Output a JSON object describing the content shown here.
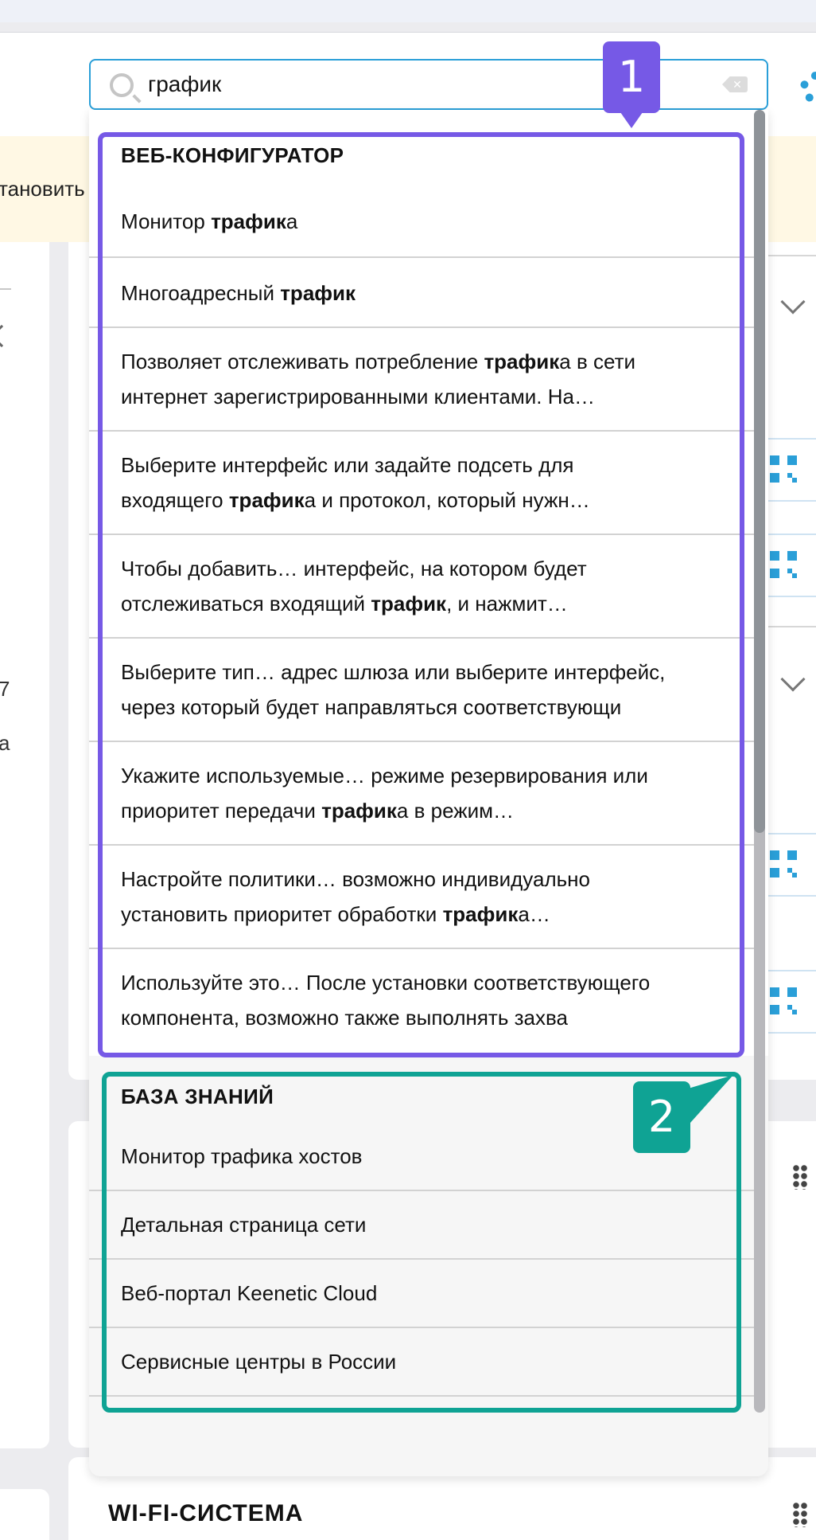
{
  "search": {
    "value": "график"
  },
  "page": {
    "notice_fragment": "тановить",
    "left_fragments": [
      "7",
      "a"
    ],
    "bottom_title": "WI-FI-СИСТЕМА"
  },
  "dropdown": {
    "web_section": {
      "title": "ВЕБ-КОНФИГУРАТОР",
      "results": [
        {
          "lines": [
            [
              {
                "t": "Монитор "
              },
              {
                "t": "трафик",
                "b": true
              },
              {
                "t": "а"
              }
            ]
          ]
        },
        {
          "lines": [
            [
              {
                "t": "Многоадресный "
              },
              {
                "t": "трафик",
                "b": true
              }
            ]
          ]
        },
        {
          "lines": [
            [
              {
                "t": "Позволяет отслеживать потребление "
              },
              {
                "t": "трафик",
                "b": true
              },
              {
                "t": "а в сети"
              }
            ],
            [
              {
                "t": "интернет зарегистрированными клиентами. На…"
              }
            ]
          ]
        },
        {
          "lines": [
            [
              {
                "t": "Выберите интерфейс или задайте подсеть для"
              }
            ],
            [
              {
                "t": "входящего "
              },
              {
                "t": "трафик",
                "b": true
              },
              {
                "t": "а и протокол, который нужн…"
              }
            ]
          ]
        },
        {
          "lines": [
            [
              {
                "t": "Чтобы добавить… интерфейс, на котором будет"
              }
            ],
            [
              {
                "t": "отслеживаться входящий "
              },
              {
                "t": "трафик",
                "b": true
              },
              {
                "t": ", и нажмит…"
              }
            ]
          ]
        },
        {
          "lines": [
            [
              {
                "t": "Выберите тип… адрес шлюза или выберите интерфейс,"
              }
            ],
            [
              {
                "t": "через который будет направляться соответствующи"
              }
            ]
          ]
        },
        {
          "lines": [
            [
              {
                "t": "Укажите используемые… режиме резервирования или"
              }
            ],
            [
              {
                "t": "приоритет передачи "
              },
              {
                "t": "трафик",
                "b": true
              },
              {
                "t": "а в режим…"
              }
            ]
          ]
        },
        {
          "lines": [
            [
              {
                "t": "Настройте политики… возможно индивидуально"
              }
            ],
            [
              {
                "t": "установить приоритет обработки "
              },
              {
                "t": "трафик",
                "b": true
              },
              {
                "t": "а…"
              }
            ]
          ]
        },
        {
          "lines": [
            [
              {
                "t": "Используйте это… После установки соответствующего"
              }
            ],
            [
              {
                "t": "компонента, возможно также выполнять захва"
              }
            ]
          ]
        }
      ]
    },
    "kb_section": {
      "title": "БАЗА ЗНАНИЙ",
      "results": [
        "Монитор трафика хостов",
        "Детальная страница сети",
        "Веб-портал Keenetic Cloud",
        "Сервисные центры в России"
      ]
    }
  },
  "annotations": {
    "badge_1": "1",
    "badge_2": "2"
  },
  "colors": {
    "accent": "#2a9fd8",
    "annotation_1": "#7659e6",
    "annotation_2": "#0fa394"
  }
}
